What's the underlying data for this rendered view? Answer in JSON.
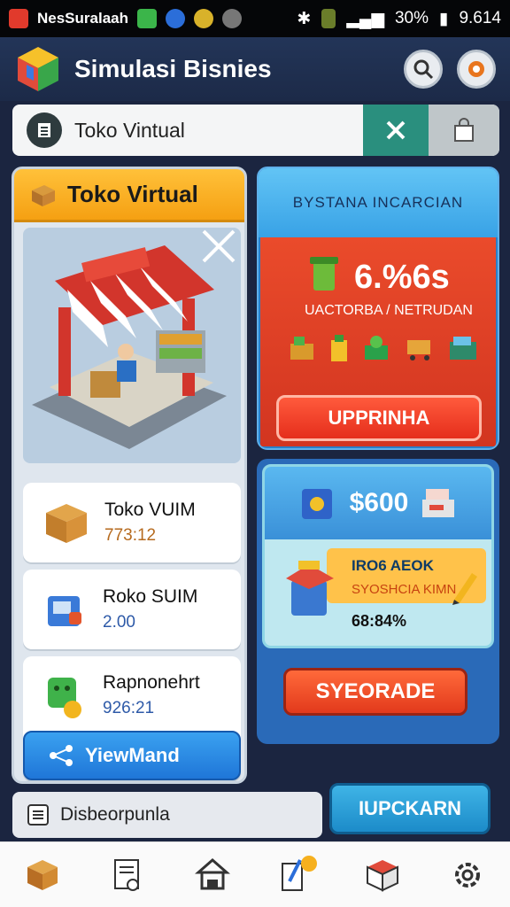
{
  "status_bar": {
    "carrier": "NesSuralaah",
    "battery": "30%",
    "time": "9.614"
  },
  "app_bar": {
    "title": "Simulasi Bisnies"
  },
  "search": {
    "placeholder": "Toko Vintual"
  },
  "left_panel": {
    "header": "Toko Virtual",
    "cards": [
      {
        "name": "Toko VUIM",
        "value": "773:12"
      },
      {
        "name": "Roko SUIM",
        "value": "2.00"
      },
      {
        "name": "Rapnonehrt",
        "value": "926:21"
      }
    ],
    "button_label": "YiewMand"
  },
  "right_panel_top": {
    "header": "BYSTANA INCARCIAN",
    "value": "6.%6s",
    "sub_label": "UACTORBA / NETRUDAN",
    "button_label": "UPPRINHA"
  },
  "right_panel_bottom": {
    "value": "$600",
    "line1": "IRO6 AEOK",
    "line2": "SYOSHCIA KIMN",
    "pct": "68:84%",
    "button_label": "SYEORADE"
  },
  "bottom_bar": {
    "label": "Disbeorpunla",
    "button_label": "IUPCKARN"
  },
  "colors": {
    "accent_orange": "#f5a012",
    "accent_red": "#e52e1c",
    "accent_blue": "#1f76d8",
    "teal": "#2a8f7e"
  }
}
